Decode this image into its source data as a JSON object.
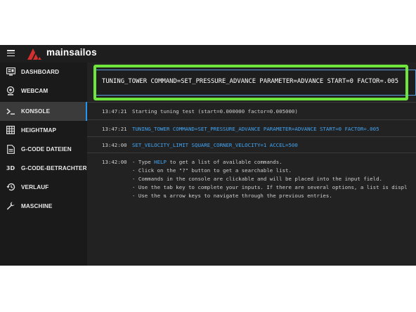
{
  "header": {
    "brand": "mainsailos",
    "accent_color": "#d32f2f"
  },
  "sidebar": {
    "items": [
      {
        "label": "DASHBOARD",
        "icon": "monitor-dashboard-icon"
      },
      {
        "label": "WEBCAM",
        "icon": "webcam-icon"
      },
      {
        "label": "KONSOLE",
        "icon": "console-icon",
        "active": true
      },
      {
        "label": "HEIGHTMAP",
        "icon": "grid-icon"
      },
      {
        "label": "G-CODE DATEIEN",
        "icon": "file-document-icon"
      },
      {
        "label": "G-CODE-BETRACHTER",
        "icon": "3d-icon"
      },
      {
        "label": "VERLAUF",
        "icon": "history-icon"
      },
      {
        "label": "MASCHINE",
        "icon": "wrench-icon"
      }
    ]
  },
  "console": {
    "command_value": "TUNING_TOWER COMMAND=SET_PRESSURE_ADVANCE PARAMETER=ADVANCE START=0 FACTOR=.005",
    "entries": [
      {
        "time": "13:47:21",
        "message": "Starting tuning test (start=0.000000 factor=0.005000)"
      },
      {
        "time": "13:47:21",
        "message": "TUNING_TOWER COMMAND=SET_PRESSURE_ADVANCE PARAMETER=ADVANCE START=0 FACTOR=.005"
      },
      {
        "time": "13:42:00",
        "message": "SET_VELOCITY_LIMIT SQUARE_CORNER_VELOCITY=1 ACCEL=500"
      },
      {
        "time": "13:42:00",
        "message": ""
      }
    ],
    "help": {
      "line1_pre": "- Type ",
      "line1_link": "HELP",
      "line1_post": " to get a list of available commands.",
      "line2": "- Click on the \"?\" button to get a searchable list.",
      "line3": "- Commands in the console are clickable and will be placed into the input field.",
      "line4": "- Use the tab key to complete your inputs. If there are several options, a list is displ",
      "line5": "- Use the ⇅ arrow keys to navigate through the previous entries."
    }
  },
  "colors": {
    "highlight": "#6ee63c",
    "link": "#42a5f5",
    "active_indicator": "#2196f3"
  }
}
